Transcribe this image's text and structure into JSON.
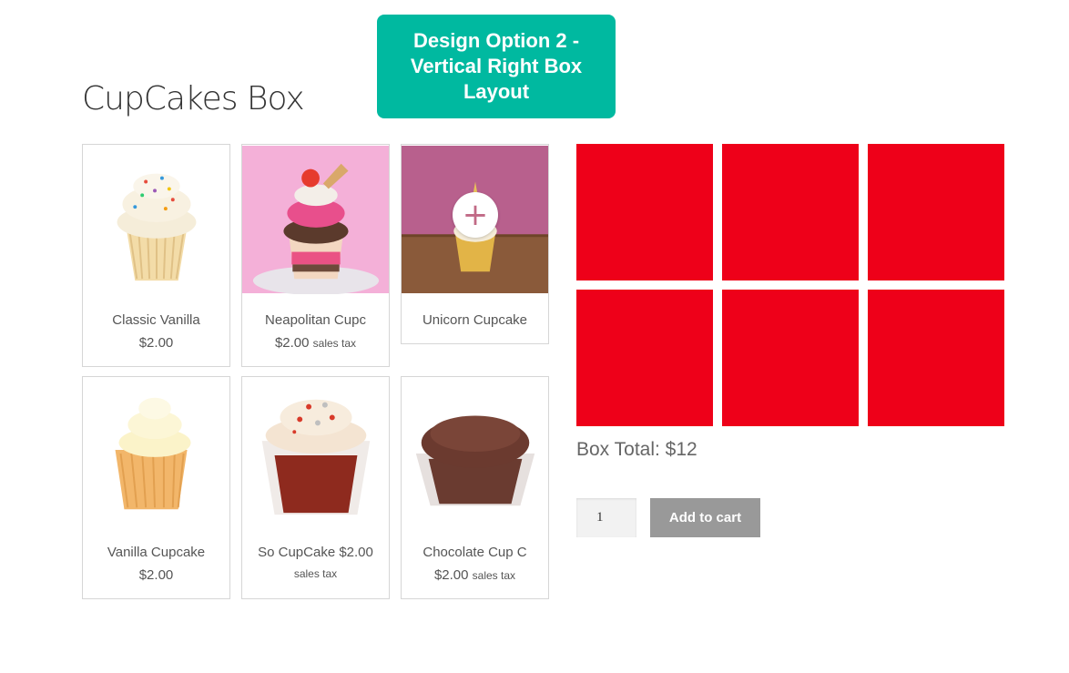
{
  "banner": {
    "text": "Design Option 2 -\nVertical Right Box\nLayout"
  },
  "page": {
    "title": "CupCakes Box"
  },
  "products": [
    {
      "name": "Classic Vanilla",
      "price": "$2.00",
      "tax": ""
    },
    {
      "name": "Neapolitan Cupc",
      "price": "$2.00",
      "tax": "sales tax"
    },
    {
      "name": "Unicorn Cupcake",
      "price": "",
      "tax": "",
      "overlay_icon": "plus-icon",
      "overlay_text": "+"
    },
    {
      "name": "Vanilla Cupcake",
      "price": "$2.00",
      "tax": ""
    },
    {
      "name": "So CupCake $2.00",
      "price": "",
      "tax": "sales tax"
    },
    {
      "name": "Chocolate Cup C",
      "price": "$2.00",
      "tax": "sales tax"
    }
  ],
  "box": {
    "slot_color": "#ee0019",
    "slot_count": 6,
    "total_label": "Box Total: $12"
  },
  "cart": {
    "quantity": "1",
    "add_label": "Add to cart"
  },
  "colors": {
    "banner": "#00b9a0",
    "button": "#999999"
  }
}
